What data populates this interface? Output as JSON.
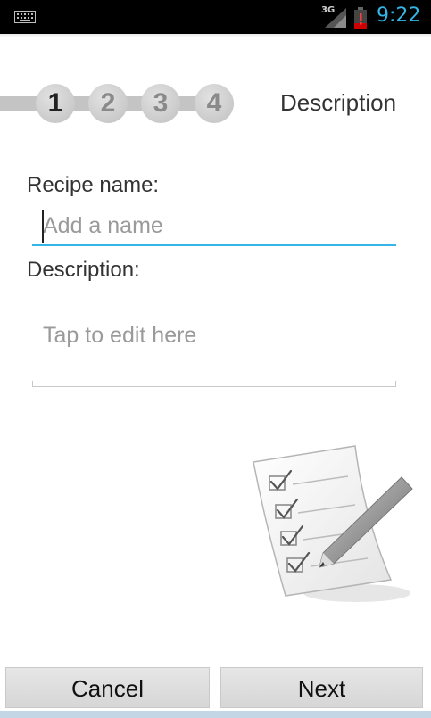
{
  "status_bar": {
    "network": "3G",
    "time": "9:22",
    "icons": [
      "keyboard-icon",
      "signal-icon",
      "battery-icon"
    ]
  },
  "wizard": {
    "steps": [
      "1",
      "2",
      "3",
      "4"
    ],
    "active_step": "1",
    "title": "Description"
  },
  "form": {
    "recipe_name_label": "Recipe name:",
    "recipe_name_placeholder": "Add a name",
    "recipe_name_value": "",
    "description_label": "Description:",
    "description_placeholder": "Tap to edit here",
    "description_value": ""
  },
  "illustration": {
    "icon": "checklist-pencil-icon"
  },
  "buttons": {
    "cancel": "Cancel",
    "next": "Next"
  },
  "colors": {
    "accent": "#33b5e5",
    "status_bar_bg": "#000000",
    "button_bg": "#dddddd"
  }
}
